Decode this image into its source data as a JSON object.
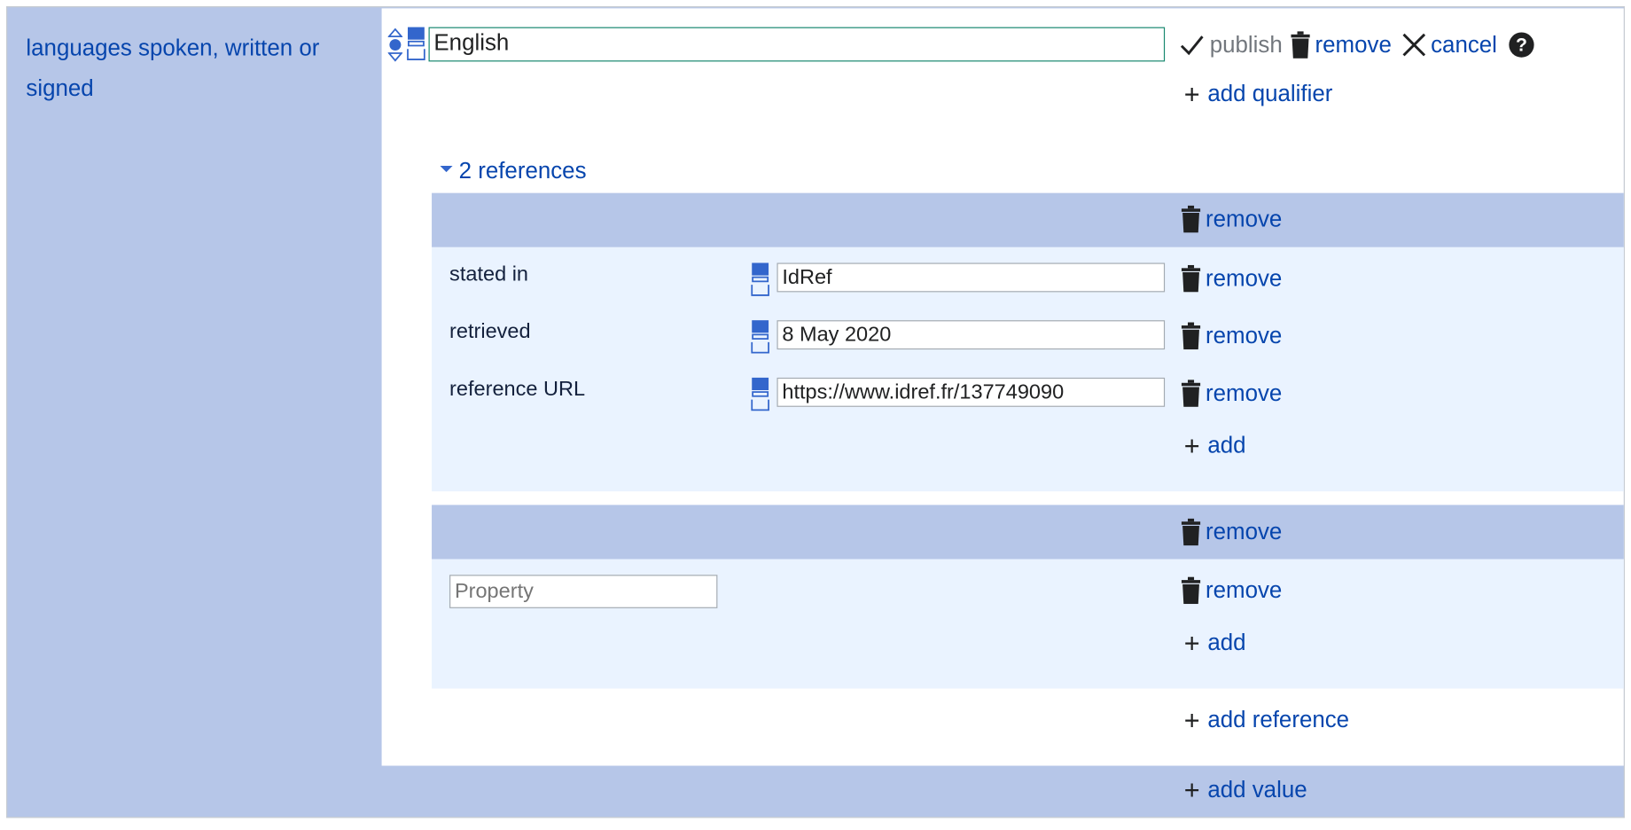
{
  "property": {
    "label": "languages spoken, written or signed"
  },
  "statement": {
    "value": "English",
    "publish_label": "publish",
    "remove_label": "remove",
    "cancel_label": "cancel",
    "help_glyph": "?",
    "add_qualifier_label": "add qualifier"
  },
  "references": {
    "toggle_label": "2 references",
    "items": [
      {
        "remove_label": "remove",
        "snaks": [
          {
            "property": "stated in",
            "value": "IdRef",
            "remove_label": "remove"
          },
          {
            "property": "retrieved",
            "value": "8 May 2020",
            "remove_label": "remove"
          },
          {
            "property": "reference URL",
            "value": "https://www.idref.fr/137749090",
            "remove_label": "remove"
          }
        ],
        "add_label": "add"
      },
      {
        "remove_label": "remove",
        "new_snak": {
          "placeholder": "Property",
          "remove_label": "remove"
        },
        "add_label": "add"
      }
    ],
    "add_reference_label": "add reference"
  },
  "add_value_label": "add value",
  "icons": {
    "rank": "rank-selector-icon",
    "snaktype": "snak-type-selector-icon",
    "publish": "check-icon",
    "remove": "trash-icon",
    "cancel": "close-icon",
    "help": "help-icon",
    "add": "plus-icon",
    "toggle": "triangle-down-icon"
  },
  "colors": {
    "link": "#0645ad",
    "band": "#b6c6e8",
    "reference_body": "#eaf3ff",
    "input_focus_border": "#14866d",
    "icon_blue": "#3366cc"
  }
}
